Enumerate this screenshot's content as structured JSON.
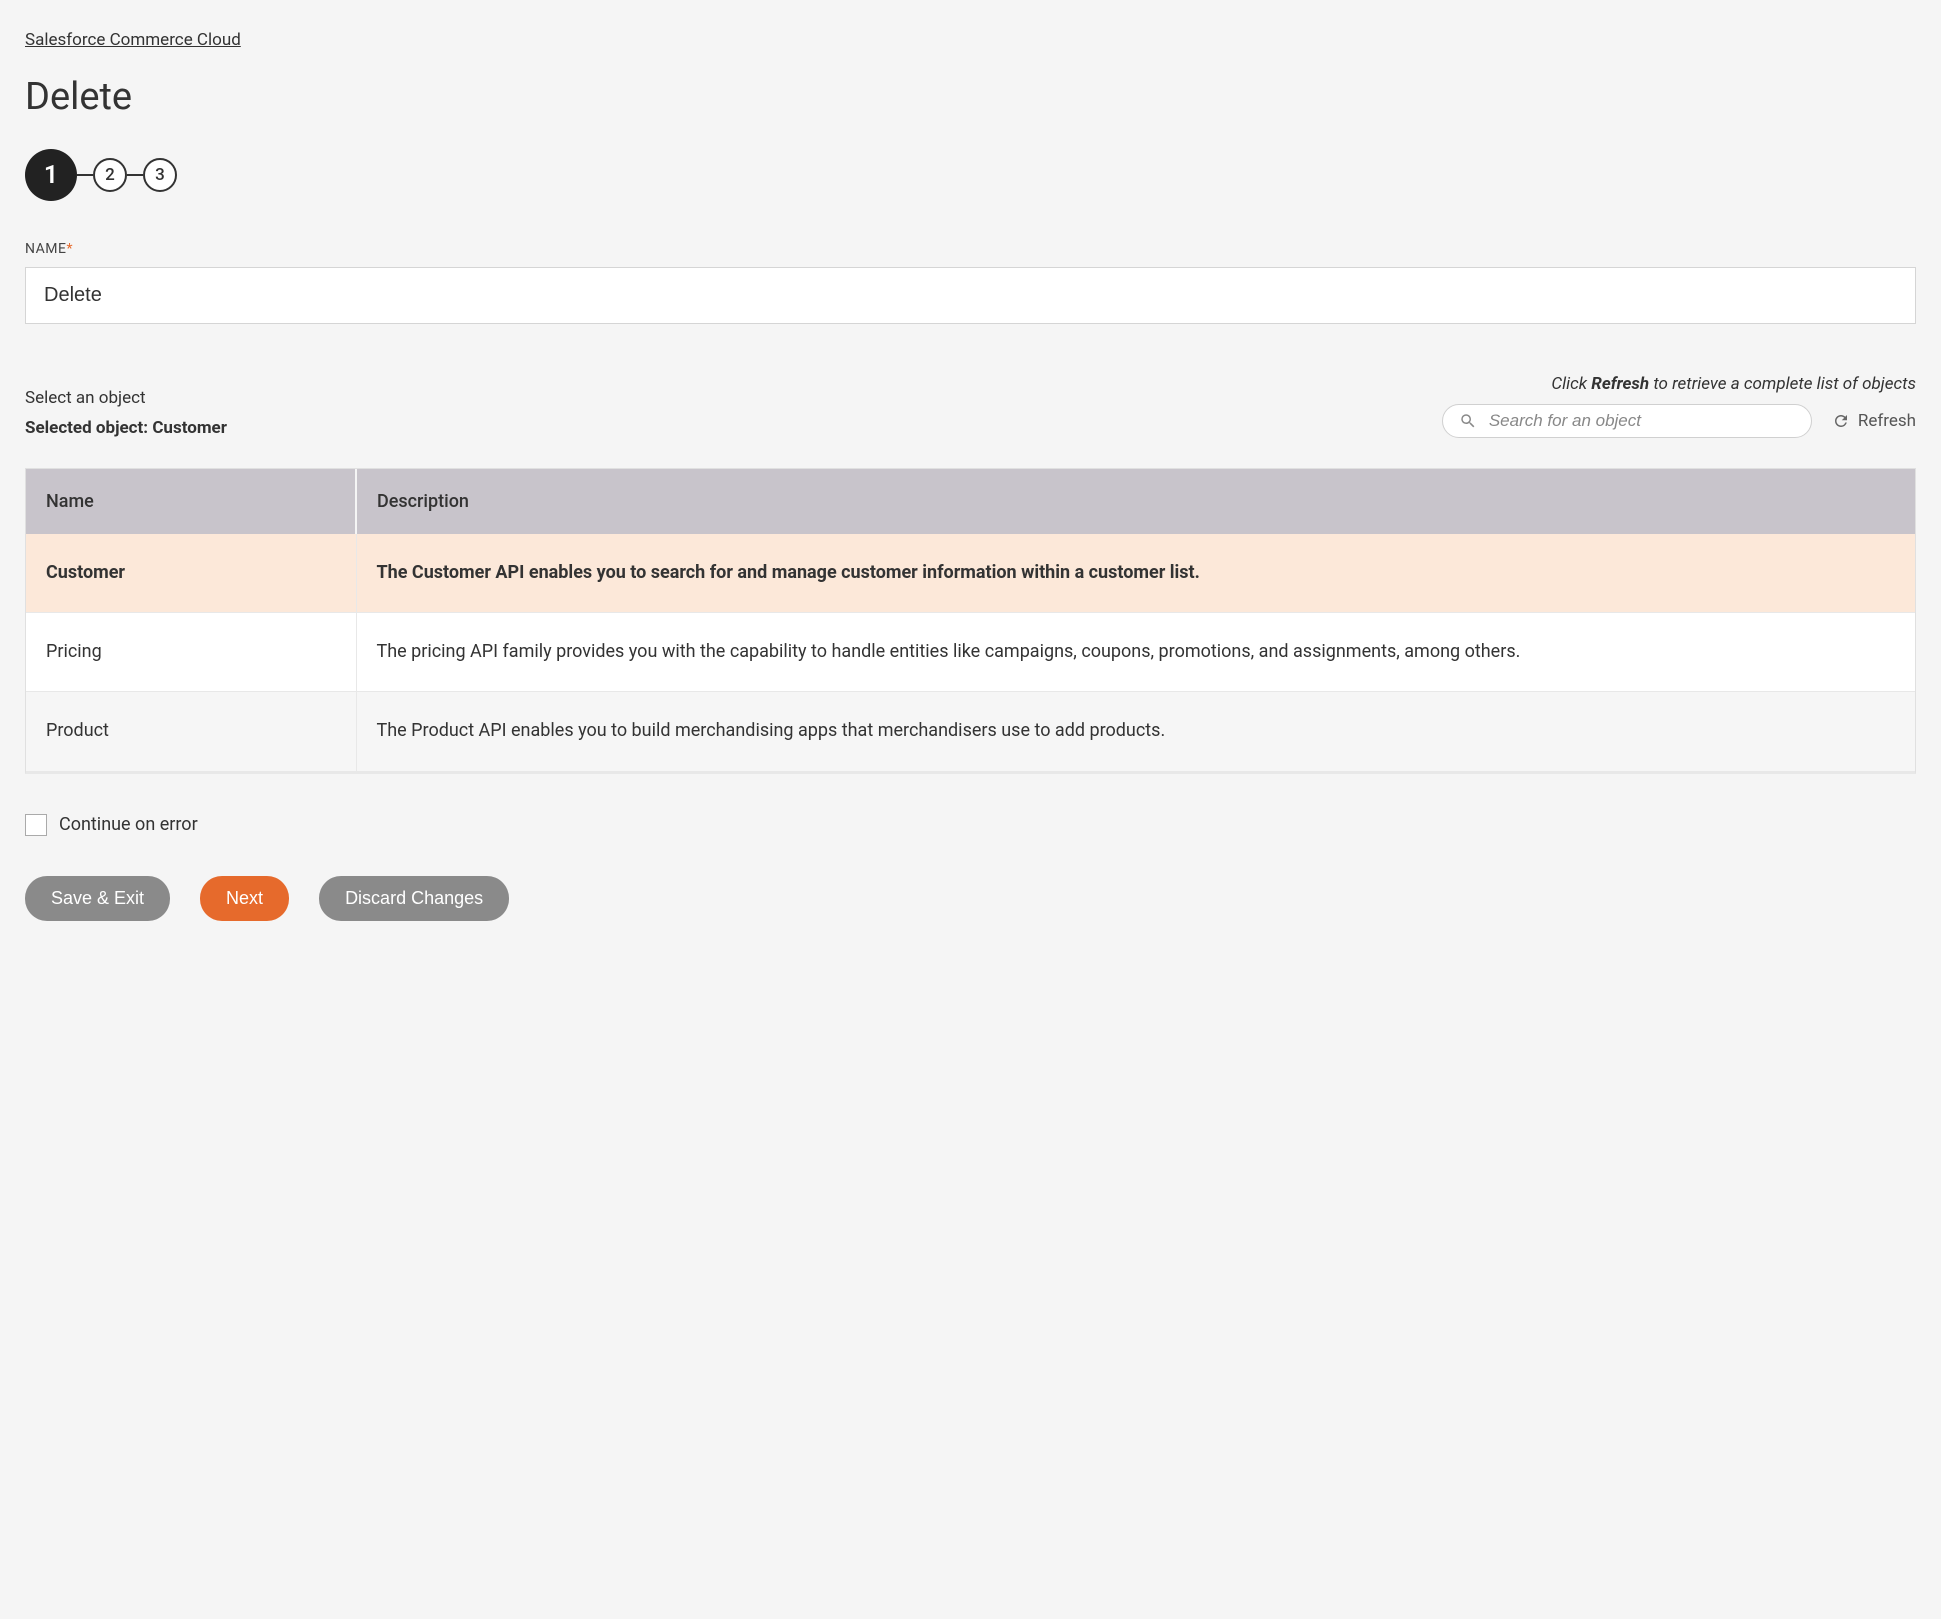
{
  "breadcrumb": "Salesforce Commerce Cloud",
  "page_title": "Delete",
  "stepper": {
    "steps": [
      "1",
      "2",
      "3"
    ],
    "active_index": 0
  },
  "name_field": {
    "label": "NAME",
    "required_mark": "*",
    "value": "Delete"
  },
  "object_section": {
    "select_hint": "Select an object",
    "refresh_hint_prefix": "Click ",
    "refresh_hint_bold": "Refresh",
    "refresh_hint_suffix": " to retrieve a complete list of objects",
    "selected_prefix": "Selected object: ",
    "selected_value": "Customer",
    "search_placeholder": "Search for an object",
    "refresh_label": "Refresh"
  },
  "table": {
    "headers": [
      "Name",
      "Description"
    ],
    "rows": [
      {
        "name": "Customer",
        "description": "The Customer API enables you to search for and manage customer information within a customer list.",
        "selected": true
      },
      {
        "name": "Pricing",
        "description": "The pricing API family provides you with the capability to handle entities like campaigns, coupons, promotions, and assignments, among others.",
        "selected": false
      },
      {
        "name": "Product",
        "description": "The Product API enables you to build merchandising apps that merchandisers use to add products.",
        "selected": false
      }
    ]
  },
  "continue_on_error_label": "Continue on error",
  "buttons": {
    "save_exit": "Save & Exit",
    "next": "Next",
    "discard": "Discard Changes"
  }
}
